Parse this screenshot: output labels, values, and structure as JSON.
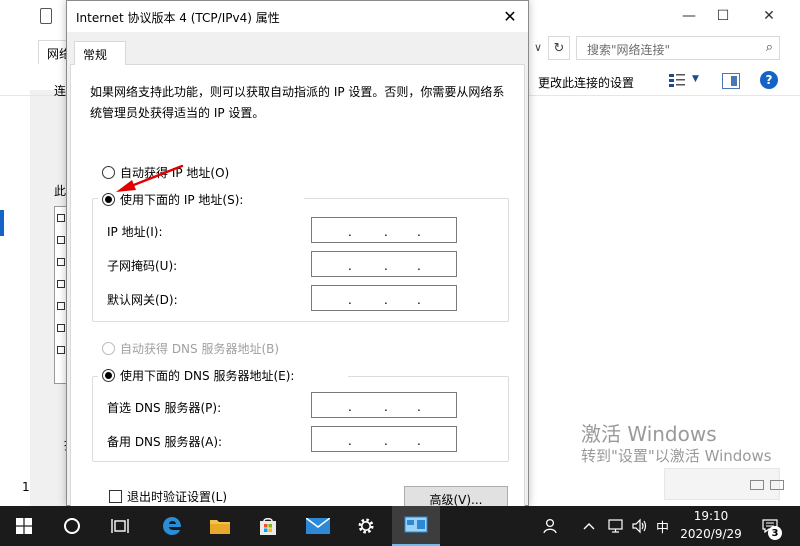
{
  "explorer": {
    "tab_label": "网络",
    "search_placeholder": "搜索\"网络连接\"",
    "change_settings": "更改此连接的设置",
    "left_labels": [
      "连",
      "此",
      "持"
    ],
    "status_count": "1"
  },
  "dialog": {
    "title": "Internet 协议版本 4 (TCP/IPv4) 属性",
    "tab_general": "常规",
    "description": "如果网络支持此功能，则可以获取自动指派的 IP 设置。否则，你需要从网络系统管理员处获得适当的 IP 设置。",
    "ip_auto_label": "自动获得 IP 地址(O)",
    "ip_manual_label": "使用下面的 IP 地址(S):",
    "ip_address_label": "IP 地址(I):",
    "subnet_label": "子网掩码(U):",
    "gateway_label": "默认网关(D):",
    "dns_auto_label": "自动获得 DNS 服务器地址(B)",
    "dns_manual_label": "使用下面的 DNS 服务器地址(E):",
    "dns_preferred_label": "首选 DNS 服务器(P):",
    "dns_alternate_label": "备用 DNS 服务器(A):",
    "validate_label": "退出时验证设置(L)",
    "advanced_button": "高级(V)...",
    "ip_auto_selected": false,
    "ip_manual_selected": true,
    "dns_auto_selected": false,
    "dns_manual_selected": true,
    "validate_checked": false
  },
  "watermark": {
    "title": "激活 Windows",
    "subtitle": "转到\"设置\"以激活 Windows"
  },
  "taskbar": {
    "time": "19:10",
    "date": "2020/9/29",
    "ime": "中",
    "notification_count": "3"
  },
  "colors": {
    "accent": "#1464c8",
    "annotation_arrow": "#e00000",
    "taskbar": "#1b1b1b"
  }
}
